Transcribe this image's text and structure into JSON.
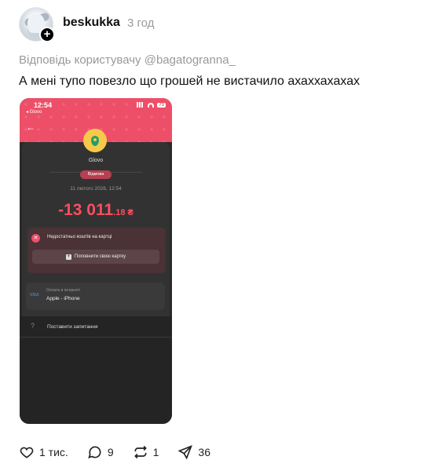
{
  "post": {
    "username": "beskukka",
    "time": "3 год",
    "reply_to": "Відповідь користувачу @bagatogranna_",
    "text": "А мені тупо повезло що грошей не вистачило ахаххахахах"
  },
  "screenshot": {
    "status_time": "12:54",
    "status_back": "◂ Glovo",
    "battery": "73",
    "merchant": "Glovo",
    "status_pill": "Відмова",
    "datetime": "11 лютого 2026, 12:54",
    "amount_main": "-13 011",
    "amount_decimal": ".18 ₴",
    "error_text": "Недостатньо коштів на картці",
    "topup_label": "Поповнити свою картку",
    "pay_brand": "VISA",
    "pay_label": "Оплата в інтернеті",
    "pay_value": "Apple - iPhone",
    "help_icon": "?",
    "help_text": "Поставити запитання",
    "accent_color": "#ee4f68",
    "amount_color": "#ff4d5e"
  },
  "actions": {
    "like_count": "1 тис.",
    "comment_count": "9",
    "repost_count": "1",
    "share_count": "36"
  }
}
